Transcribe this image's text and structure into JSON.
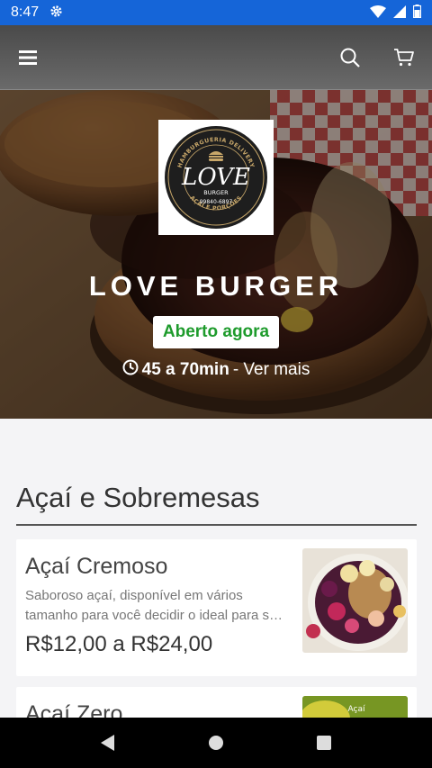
{
  "status_bar": {
    "time": "8:47",
    "icons": [
      "gear-icon",
      "wifi-icon",
      "signal-icon",
      "battery-icon"
    ]
  },
  "app_bar": {
    "icons": [
      "menu-icon",
      "search-icon",
      "cart-icon"
    ]
  },
  "hero": {
    "logo": {
      "arc_top": "HAMBURGUERIA DELIVERY",
      "wordmark": "LOVE",
      "sub": "BURGER",
      "phone": "99840-6897",
      "arc_bottom": "AÇAÍ E PORÇÕES"
    },
    "restaurant_name": "LOVE BURGER",
    "status_badge": "Aberto agora",
    "delivery_time": "45 a 70min",
    "see_more": "- Ver mais"
  },
  "section": {
    "title": "Açaí e Sobremesas"
  },
  "products": [
    {
      "name": "Açaí Cremoso",
      "description": "Saboroso açaí, disponível em vários tamanho para você decidir o ideal para s…",
      "price": "R$12,00 a R$24,00"
    },
    {
      "name": "Açaí Zero",
      "image_label": "Açaí"
    }
  ],
  "colors": {
    "status_bar": "#1565d8",
    "app_bar": "#555555",
    "open_green": "#1e9b2c",
    "background": "#f4f4f6"
  },
  "nav_bar": {
    "icons": [
      "back-icon",
      "home-icon",
      "recents-icon"
    ]
  }
}
